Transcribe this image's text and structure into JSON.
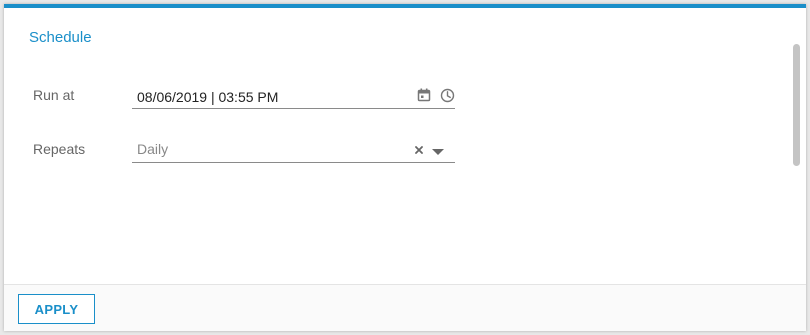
{
  "panel": {
    "title": "Schedule",
    "accent_color": "#1a8fc9"
  },
  "form": {
    "run_at": {
      "label": "Run at",
      "value": "08/06/2019 | 03:55 PM",
      "icons": [
        "calendar-icon",
        "clock-icon"
      ]
    },
    "repeats": {
      "label": "Repeats",
      "value": "Daily",
      "icons": [
        "clear-icon",
        "dropdown-arrow-icon"
      ]
    }
  },
  "footer": {
    "apply_label": "APPLY"
  }
}
